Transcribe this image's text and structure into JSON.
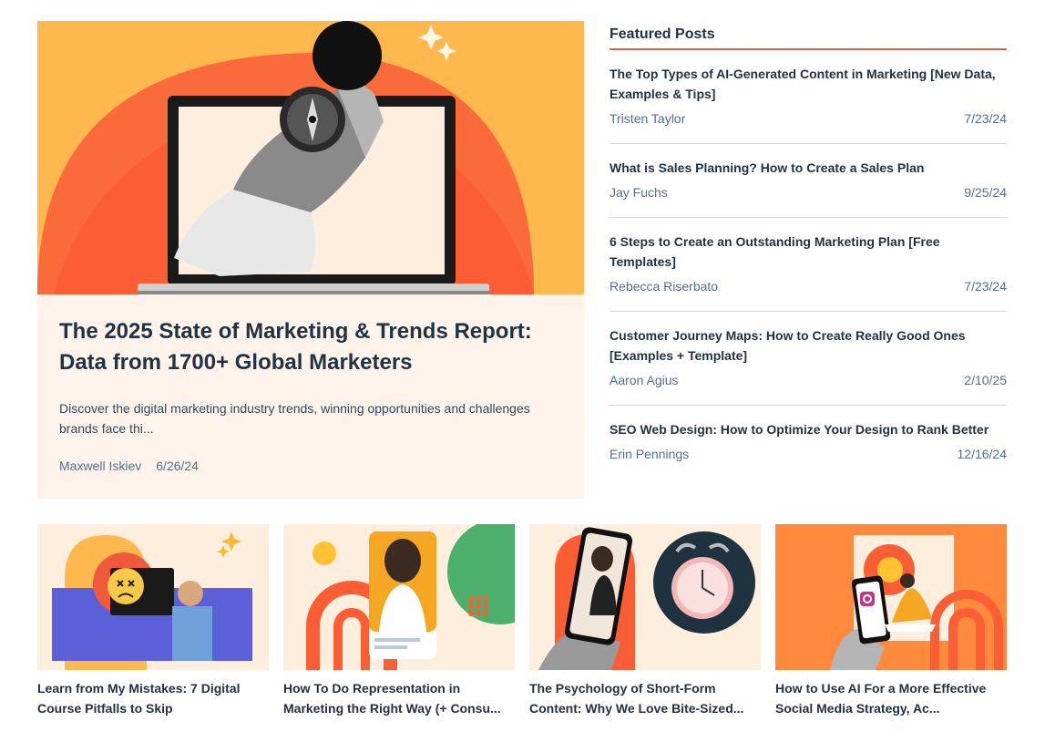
{
  "hero": {
    "title": "The 2025 State of Marketing & Trends Report: Data from 1700+ Global Marketers",
    "description": "Discover the digital marketing industry trends, winning opportunities and challenges brands face thi...",
    "author": "Maxwell Iskiev",
    "date": "6/26/24",
    "image_icon": "compass-laptop-illustration"
  },
  "featured": {
    "heading": "Featured Posts",
    "items": [
      {
        "title": "The Top Types of AI-Generated Content in Marketing [New Data, Examples & Tips]",
        "author": "Tristen Taylor",
        "date": "7/23/24"
      },
      {
        "title": "What is Sales Planning? How to Create a Sales Plan",
        "author": "Jay Fuchs",
        "date": "9/25/24"
      },
      {
        "title": "6 Steps to Create an Outstanding Marketing Plan [Free Templates]",
        "author": "Rebecca Riserbato",
        "date": "7/23/24"
      },
      {
        "title": "Customer Journey Maps: How to Create Really Good Ones [Examples + Template]",
        "author": "Aaron Agius",
        "date": "2/10/25"
      },
      {
        "title": "SEO Web Design: How to Optimize Your Design to Rank Better",
        "author": "Erin Pennings",
        "date": "12/16/24"
      }
    ]
  },
  "cards": [
    {
      "title": "Learn from My Mistakes: 7 Digital Course Pitfalls to Skip",
      "image_icon": "sad-face-laptop-illustration"
    },
    {
      "title": "How To Do Representation in Marketing the Right Way (+ Consu...",
      "image_icon": "headphones-woman-illustration"
    },
    {
      "title": "The Psychology of Short-Form Content: Why We Love Bite-Sized...",
      "image_icon": "phone-alarm-clock-illustration"
    },
    {
      "title": "How to Use AI For a More Effective Social Media Strategy, Ac...",
      "image_icon": "social-media-phone-illustration"
    }
  ],
  "colors": {
    "accent": "#e8613c",
    "orange_bg": "#ffb84d",
    "cream": "#fdf3ea",
    "text": "#213343",
    "meta": "#516f90"
  }
}
